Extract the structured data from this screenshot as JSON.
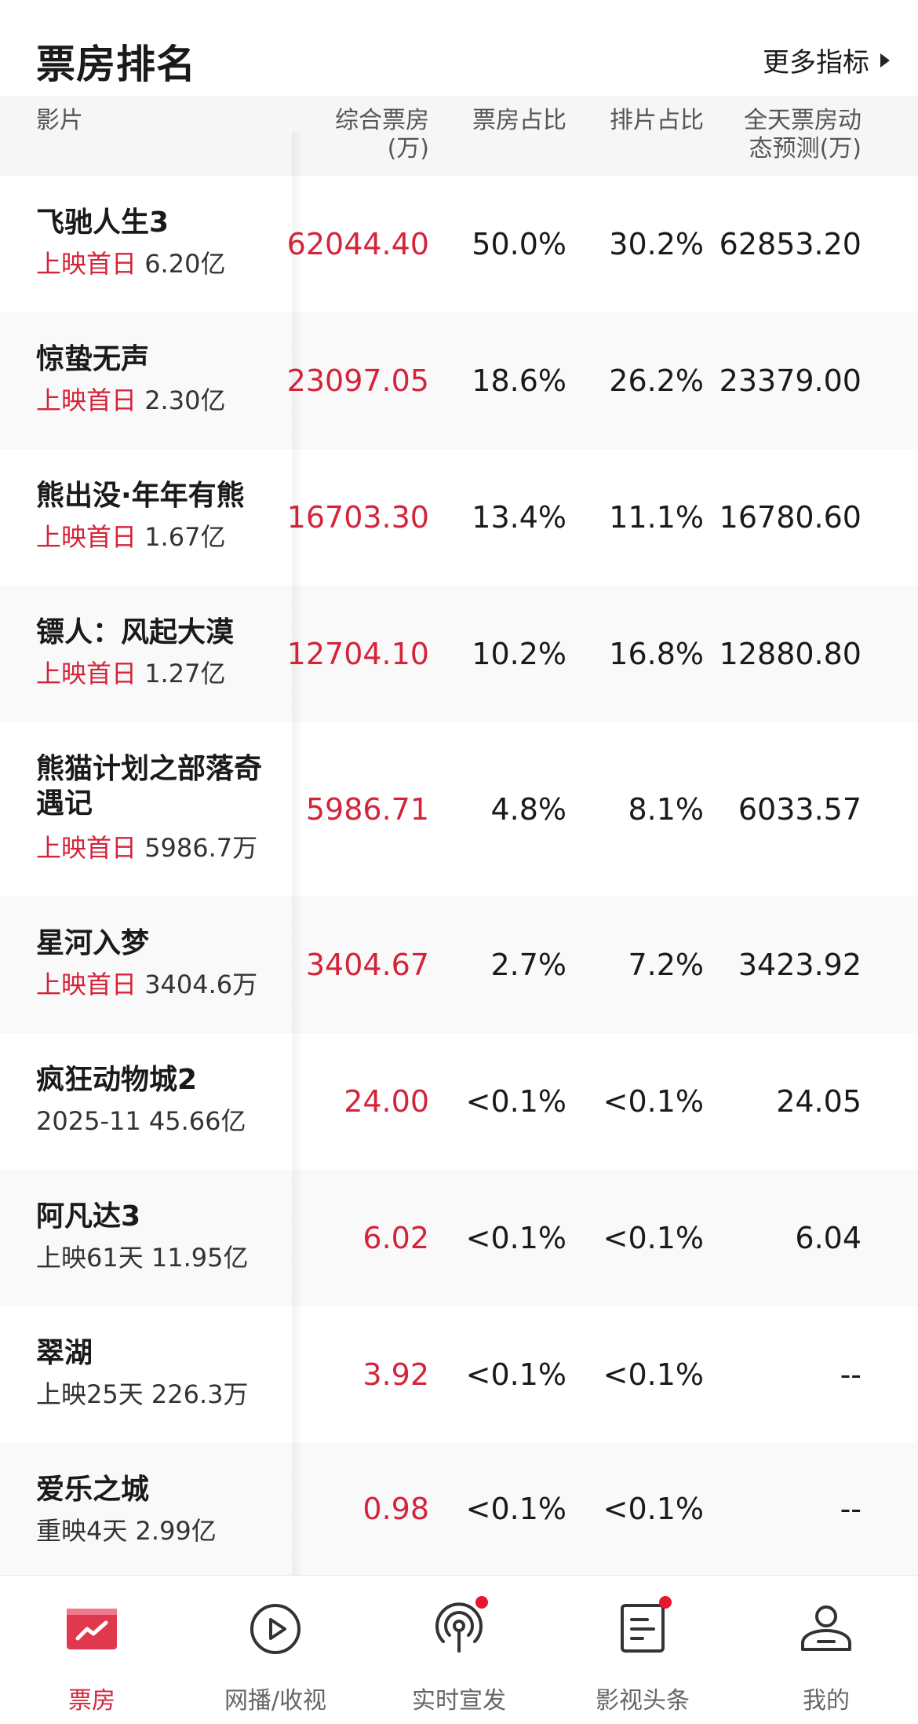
{
  "header": {
    "title": "票房排名",
    "more_label": "更多指标"
  },
  "columns": {
    "film": "影片",
    "box_line1": "综合票房",
    "box_line2": "(万)",
    "share": "票房占比",
    "schedule": "排片占比",
    "pred_line1": "全天票房动",
    "pred_line2": "态预测(万)"
  },
  "rows": [
    {
      "name": "飞驰人生3",
      "tag": "上映首日",
      "info": " 6.20亿",
      "box": "62044.40",
      "share": "50.0%",
      "schedule": "30.2%",
      "prediction": "62853.20"
    },
    {
      "name": "惊蛰无声",
      "tag": "上映首日",
      "info": " 2.30亿",
      "box": "23097.05",
      "share": "18.6%",
      "schedule": "26.2%",
      "prediction": "23379.00"
    },
    {
      "name": "熊出没·年年有熊",
      "tag": "上映首日",
      "info": " 1.67亿",
      "box": "16703.30",
      "share": "13.4%",
      "schedule": "11.1%",
      "prediction": "16780.60"
    },
    {
      "name": "镖人：风起大漠",
      "tag": "上映首日",
      "info": " 1.27亿",
      "box": "12704.10",
      "share": "10.2%",
      "schedule": "16.8%",
      "prediction": "12880.80"
    },
    {
      "name": "熊猫计划之部落奇遇记",
      "tag": "上映首日",
      "info": " 5986.7万",
      "box": "5986.71",
      "share": "4.8%",
      "schedule": "8.1%",
      "prediction": "6033.57"
    },
    {
      "name": "星河入梦",
      "tag": "上映首日",
      "info": " 3404.6万",
      "box": "3404.67",
      "share": "2.7%",
      "schedule": "7.2%",
      "prediction": "3423.92"
    },
    {
      "name": "疯狂动物城2",
      "tag": "",
      "info": "2025-11 45.66亿",
      "box": "24.00",
      "share": "<0.1%",
      "schedule": "<0.1%",
      "prediction": "24.05"
    },
    {
      "name": "阿凡达3",
      "tag": "",
      "info": "上映61天 11.95亿",
      "box": "6.02",
      "share": "<0.1%",
      "schedule": "<0.1%",
      "prediction": "6.04"
    },
    {
      "name": "翠湖",
      "tag": "",
      "info": "上映25天 226.3万",
      "box": "3.92",
      "share": "<0.1%",
      "schedule": "<0.1%",
      "prediction": "--"
    },
    {
      "name": "爱乐之城",
      "tag": "",
      "info": "重映4天 2.99亿",
      "box": "0.98",
      "share": "<0.1%",
      "schedule": "<0.1%",
      "prediction": "--"
    }
  ],
  "tabs": [
    {
      "label": "票房",
      "icon": "box-office-chart-icon",
      "active": true,
      "badge": false
    },
    {
      "label": "网播/收视",
      "icon": "play-circle-icon",
      "active": false,
      "badge": false
    },
    {
      "label": "实时宣发",
      "icon": "broadcast-icon",
      "active": false,
      "badge": true
    },
    {
      "label": "影视头条",
      "icon": "news-document-icon",
      "active": false,
      "badge": true
    },
    {
      "label": "我的",
      "icon": "user-icon",
      "active": false,
      "badge": false
    }
  ],
  "colors": {
    "accent": "#d4243a",
    "badge": "#e8162f",
    "header_bg": "#f6f6f6"
  }
}
